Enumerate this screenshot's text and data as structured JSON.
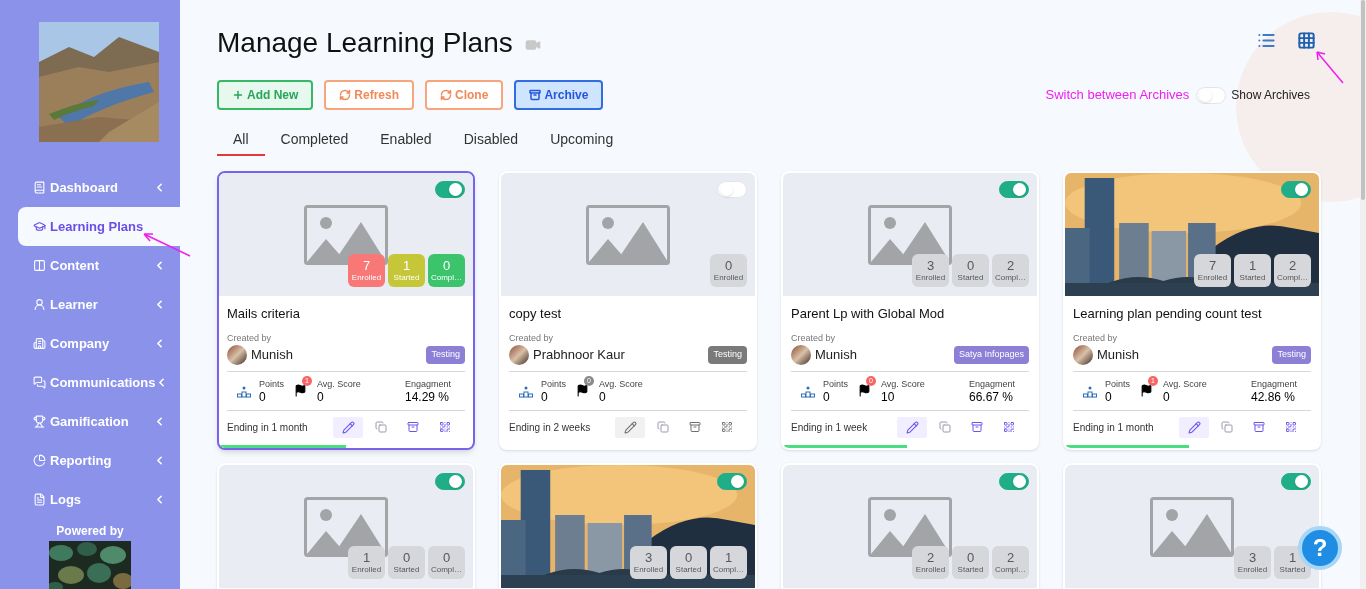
{
  "sidebar": {
    "items": [
      {
        "label": "Dashboard",
        "selected": false,
        "expandable": true
      },
      {
        "label": "Learning Plans",
        "selected": true,
        "expandable": false
      },
      {
        "label": "Content",
        "selected": false,
        "expandable": true
      },
      {
        "label": "Learner",
        "selected": false,
        "expandable": true
      },
      {
        "label": "Company",
        "selected": false,
        "expandable": true
      },
      {
        "label": "Communications",
        "selected": false,
        "expandable": true
      },
      {
        "label": "Gamification",
        "selected": false,
        "expandable": true
      },
      {
        "label": "Reporting",
        "selected": false,
        "expandable": true
      },
      {
        "label": "Logs",
        "selected": false,
        "expandable": true
      }
    ],
    "powered_by": "Powered by"
  },
  "title": "Manage Learning Plans",
  "actions": [
    {
      "label": "Add New",
      "kind": "add"
    },
    {
      "label": "Refresh",
      "kind": "refresh"
    },
    {
      "label": "Clone",
      "kind": "clone"
    },
    {
      "label": "Archive",
      "kind": "archive"
    }
  ],
  "view_modes": [
    {
      "kind": "list",
      "selected": false
    },
    {
      "kind": "grid",
      "selected": true
    }
  ],
  "annotation": "Switch between Archives",
  "show_archives": {
    "label": "Show Archives",
    "on": false
  },
  "tabs": [
    {
      "label": "All",
      "selected": true
    },
    {
      "label": "Completed",
      "selected": false
    },
    {
      "label": "Enabled",
      "selected": false
    },
    {
      "label": "Disabled",
      "selected": false
    },
    {
      "label": "Upcoming",
      "selected": false
    }
  ],
  "cards": [
    {
      "title": "Mails criteria",
      "enabled": true,
      "selected": true,
      "kind": "placeholder",
      "stats": [
        {
          "value": "7",
          "label": "Enrolled",
          "color": "#f87878"
        },
        {
          "value": "1",
          "label": "Started",
          "color": "#c6c639"
        },
        {
          "value": "0",
          "label": "Compl…",
          "color": "#3cc46c"
        }
      ],
      "created_by_label": "Created by",
      "author": "Munish",
      "tag": {
        "text": "Testing",
        "color": "#8b7fd6"
      },
      "points_label": "Points",
      "points": "0",
      "flag": {
        "count": "1",
        "color": "#f86565"
      },
      "avg_label": "Avg. Score",
      "avg": "0",
      "engagement_label": "Engagment",
      "engagement": "14.29 %",
      "ending": "Ending in 1 month",
      "level": 0.5
    },
    {
      "title": "copy test",
      "enabled": false,
      "selected": false,
      "kind": "placeholder",
      "stats": [
        {
          "value": "0",
          "label": "Enrolled"
        }
      ],
      "created_by_label": "Created by",
      "author": "Prabhnoor Kaur",
      "tag": {
        "text": "Testing",
        "color": "#7a7a7a"
      },
      "points_label": "Points",
      "points": "0",
      "flag": {
        "count": "0",
        "color": "#8a8a8a"
      },
      "avg_label": "Avg. Score",
      "avg": "0",
      "ending": "Ending in 2 weeks"
    },
    {
      "title": "Parent Lp with Global Mod",
      "enabled": true,
      "selected": false,
      "kind": "placeholder",
      "stats": [
        {
          "value": "3",
          "label": "Enrolled"
        },
        {
          "value": "0",
          "label": "Started"
        },
        {
          "value": "2",
          "label": "Compl…"
        }
      ],
      "created_by_label": "Created by",
      "author": "Munish",
      "tag": {
        "text": "Satya Infopages",
        "color": "#8b7fd6"
      },
      "points_label": "Points",
      "points": "0",
      "flag": {
        "count": "0",
        "color": "#f86565"
      },
      "avg_label": "Avg. Score",
      "avg": "10",
      "engagement_label": "Engagment",
      "engagement": "66.67 %",
      "ending": "Ending in 1 week",
      "level": 0.49
    },
    {
      "title": "Learning plan pending count test",
      "enabled": true,
      "selected": false,
      "kind": "picture",
      "stats": [
        {
          "value": "7",
          "label": "Enrolled"
        },
        {
          "value": "1",
          "label": "Started"
        },
        {
          "value": "2",
          "label": "Compl…"
        }
      ],
      "created_by_label": "Created by",
      "author": "Munish",
      "tag": {
        "text": "Testing",
        "color": "#8b7fd6"
      },
      "points_label": "Points",
      "points": "0",
      "flag": {
        "count": "1",
        "color": "#f86565"
      },
      "avg_label": "Avg. Score",
      "avg": "0",
      "engagement_label": "Engagment",
      "engagement": "42.86 %",
      "ending": "Ending in 1 month",
      "level": 0.49
    },
    {
      "enabled": true,
      "selected": false,
      "kind": "placeholder",
      "stats": [
        {
          "value": "1",
          "label": "Enrolled"
        },
        {
          "value": "0",
          "label": "Started"
        },
        {
          "value": "0",
          "label": "Compl…"
        }
      ]
    },
    {
      "enabled": true,
      "selected": false,
      "kind": "picture",
      "stats": [
        {
          "value": "3",
          "label": "Enrolled"
        },
        {
          "value": "0",
          "label": "Started"
        },
        {
          "value": "1",
          "label": "Compl…"
        }
      ]
    },
    {
      "enabled": true,
      "selected": false,
      "kind": "placeholder",
      "stats": [
        {
          "value": "2",
          "label": "Enrolled"
        },
        {
          "value": "0",
          "label": "Started"
        },
        {
          "value": "2",
          "label": "Compl…"
        }
      ]
    },
    {
      "enabled": true,
      "selected": false,
      "kind": "placeholder",
      "stats": [
        {
          "value": "3",
          "label": "Enrolled"
        },
        {
          "value": "1",
          "label": "Started"
        }
      ]
    }
  ],
  "help": "?"
}
